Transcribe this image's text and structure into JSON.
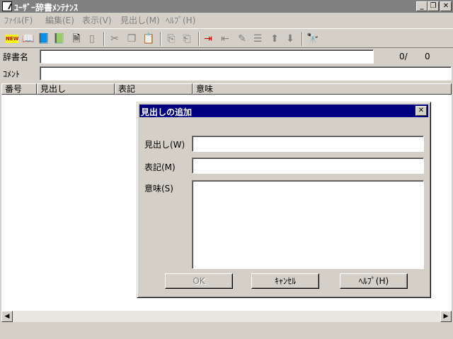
{
  "window": {
    "title": "ﾕｰｻﾞｰ辞書ﾒﾝﾃﾅﾝｽ",
    "min_glyph": "_",
    "restore_glyph": "❐",
    "close_glyph": "✕"
  },
  "menu": {
    "items": [
      "ﾌｧｲﾙ(F)",
      "編集(E)",
      "表示(V)",
      "見出し(M)",
      "ﾍﾙﾌﾟ(H)"
    ]
  },
  "toolbar": {
    "new_label": "NEW"
  },
  "fields": {
    "dict_label": "辞書名",
    "dict_value": "",
    "count": "0/",
    "total": "0",
    "comment_label": "ｺﾒﾝﾄ",
    "comment_value": ""
  },
  "list": {
    "columns": [
      "番号",
      "見出し",
      "表記",
      "意味"
    ],
    "rows": []
  },
  "dialog": {
    "title": "見出しの追加",
    "heading_label": "見出し(W)",
    "notation_label": "表記(M)",
    "meaning_label": "意味(S)",
    "heading_value": "",
    "notation_value": "",
    "meaning_value": "",
    "ok": "OK",
    "cancel": "ｷｬﾝｾﾙ",
    "help": "ﾍﾙﾌﾟ(H)"
  }
}
